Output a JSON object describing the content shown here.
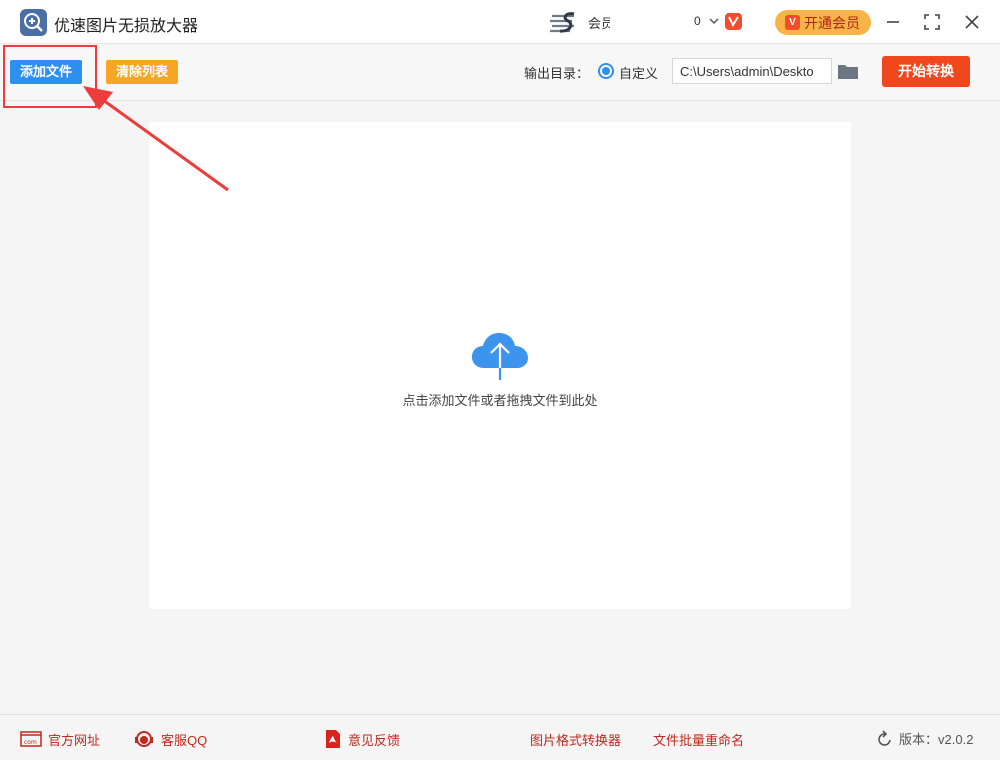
{
  "window": {
    "title": "优速图片无损放大器",
    "user_name": "会员",
    "user_id": "0",
    "vip_button_label": "开通会员",
    "vip_badge": "V"
  },
  "toolbar": {
    "add_label": "添加文件",
    "clear_label": "清除列表",
    "output_label": "输出目录：",
    "radio_label": "自定义",
    "path_value": "C:\\Users\\admin\\Deskto",
    "start_label": "开始转换"
  },
  "drop": {
    "hint": "点击添加文件或者拖拽文件到此处"
  },
  "footer": {
    "website": "官方网址",
    "service": "客服QQ",
    "feedback": "意见反馈",
    "converter": "图片格式转换器",
    "renamer": "文件批量重命名",
    "version_label": "版本：",
    "version_value": "v2.0.2"
  },
  "colors": {
    "accent_blue": "#2f8ff0",
    "accent_orange": "#f5a623",
    "start_red": "#f1471d",
    "footer_red": "#c2281d",
    "annotation_red": "#ee3c3c"
  }
}
